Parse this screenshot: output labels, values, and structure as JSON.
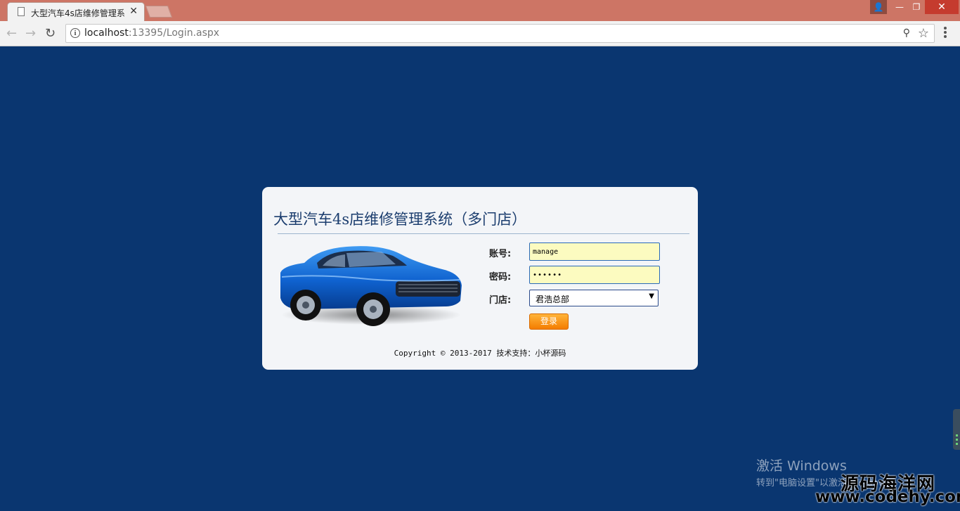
{
  "browser": {
    "tab_title": "大型汽车4s店维修管理系",
    "tab_close": "✕",
    "url_host": "localhost",
    "url_path": ":13395/Login.aspx",
    "window_user": "👤",
    "window_minimize": "—",
    "window_maximize": "❐",
    "window_close": "✕",
    "nav_back": "←",
    "nav_forward": "→",
    "nav_reload": "↻",
    "key_icon": "⚲",
    "star_icon": "☆",
    "info_icon": "i"
  },
  "login": {
    "title": "大型汽车4s店维修管理系统（多门店）",
    "account_label": "账号:",
    "account_value": "manage",
    "password_label": "密码:",
    "password_value": "••••••",
    "store_label": "门店:",
    "store_selected": "君浩总部",
    "login_button": "登录",
    "copyright": "Copyright © 2013-2017 技术支持：小杯源码"
  },
  "overlay": {
    "activate_title": "激活 Windows",
    "activate_sub": "转到\"电脑设置\"以激活 Windows",
    "watermark_cn": "源码海洋网",
    "watermark_url": "www.codehy.com"
  },
  "colors": {
    "page_background": "#0a3670",
    "titlebar": "#cd7565",
    "login_button": "#f47d00",
    "input_fill": "#fcfbc0"
  }
}
